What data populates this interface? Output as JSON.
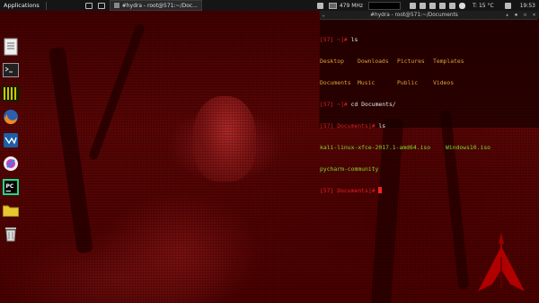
{
  "panel": {
    "applications_label": "Applications",
    "task": {
      "title": "#hydra - root@571:~/Doc...",
      "icon": "terminal-icon"
    },
    "cpu_freq": "479 MHz",
    "temperature": "T: 15 °C",
    "clock": "19:53",
    "tray_icons": [
      "bluetooth-icon",
      "clipboard-icon",
      "network-icon",
      "volume-icon",
      "settings-icon",
      "weather-icon",
      "power-icon"
    ]
  },
  "dock": {
    "items": [
      {
        "name": "document-viewer",
        "icon": "document-icon"
      },
      {
        "name": "terminal",
        "icon": "terminal-icon"
      },
      {
        "name": "matrix",
        "icon": "matrix-icon"
      },
      {
        "name": "firefox",
        "icon": "firefox-icon"
      },
      {
        "name": "wireshark",
        "icon": "wireshark-icon"
      },
      {
        "name": "maltego",
        "icon": "maltego-icon"
      },
      {
        "name": "pycharm",
        "icon": "pycharm-icon"
      },
      {
        "name": "files",
        "icon": "folder-icon"
      },
      {
        "name": "trash",
        "icon": "trash-icon"
      }
    ]
  },
  "terminal": {
    "title": "#hydra - root@571:~/Documents",
    "lines": [
      {
        "prompt": "[57]",
        "dir": " ~]# ",
        "cmd": "ls"
      },
      {
        "ls": [
          "Desktop",
          "Downloads",
          "Pictures",
          "Templates"
        ]
      },
      {
        "ls": [
          "Documents",
          "Music",
          "Public",
          "Videos"
        ]
      },
      {
        "prompt": "[57]",
        "dir": " ~]# ",
        "cmd": "cd Documents/"
      },
      {
        "prompt": "[57]",
        "dir": " Documents]# ",
        "cmd": "ls"
      },
      {
        "files": [
          "kali-linux-xfce-2017.1-amd64.iso",
          "Windows10.iso"
        ]
      },
      {
        "files": [
          "pycharm-community"
        ]
      },
      {
        "prompt": "[57]",
        "dir": " Documents]# ",
        "cmd": ""
      }
    ]
  },
  "colors": {
    "prompt": "#e02020",
    "ls_dir": "#e0a030",
    "ls_file": "#7fdc34",
    "panel_bg": "#151515"
  }
}
